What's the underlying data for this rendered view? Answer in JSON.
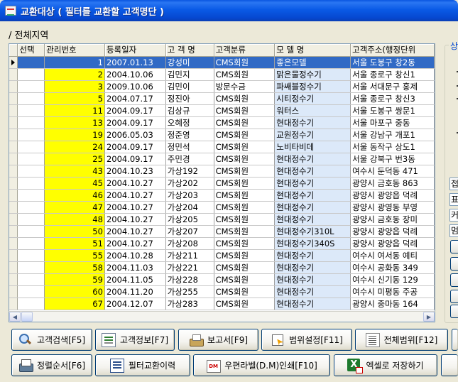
{
  "window": {
    "title": "교환대상 ( 필터를 교환할 고객명단 )"
  },
  "region": {
    "label": "/ 전체지역"
  },
  "grid": {
    "columns": [
      "선택",
      "관리번호",
      "등록일자",
      "고 객 명",
      "고객분류",
      "모 델 명",
      "고객주소(행정단위"
    ],
    "rows": [
      [
        "",
        "1",
        "2007.01.13",
        "강성미",
        "CMS회원",
        "좋은모델",
        "서울 도봉구 창2동"
      ],
      [
        "",
        "2",
        "2004.10.06",
        "김민지",
        "CMS회원",
        "맑은물정수기",
        "서울 종로구 창신1"
      ],
      [
        "",
        "3",
        "2009.10.06",
        "김민이",
        "방문수금",
        "파쌔블정수기",
        "서울 서대문구 홍제"
      ],
      [
        "",
        "5",
        "2004.07.17",
        "정진아",
        "CMS회원",
        "시티정수기",
        "서울 종로구 창신3"
      ],
      [
        "",
        "11",
        "2004.09.17",
        "김상규",
        "CMS회원",
        "워터스",
        "서울 도봉구 쌍문1"
      ],
      [
        "",
        "13",
        "2004.09.17",
        "오혜정",
        "CMS회원",
        "현대정수기",
        "서울 마포구 중동"
      ],
      [
        "",
        "19",
        "2006.05.03",
        "정준영",
        "CMS회원",
        "교원정수기",
        "서울 강남구 개포1"
      ],
      [
        "",
        "24",
        "2004.09.17",
        "정민석",
        "CMS회원",
        "노비타비데",
        "서울 동작구 상도1"
      ],
      [
        "",
        "25",
        "2004.09.17",
        "주민경",
        "CMS회원",
        "현대정수기",
        "서울 강북구 번3동"
      ],
      [
        "",
        "43",
        "2004.10.23",
        "가상192",
        "CMS회원",
        "현대정수기",
        "여수시 둔덕동 471"
      ],
      [
        "",
        "45",
        "2004.10.27",
        "가상202",
        "CMS회원",
        "현대정수기",
        "광양시 금호동 863"
      ],
      [
        "",
        "46",
        "2004.10.27",
        "가상203",
        "CMS회원",
        "현대정수기",
        "광양시 광양읍 덕례"
      ],
      [
        "",
        "47",
        "2004.10.27",
        "가상204",
        "CMS회원",
        "현대정수기",
        "광양시 광영동 부영"
      ],
      [
        "",
        "48",
        "2004.10.27",
        "가상205",
        "CMS회원",
        "현대정수기",
        "광양시 금호동 장미"
      ],
      [
        "",
        "50",
        "2004.10.27",
        "가상207",
        "CMS회원",
        "현대정수기310L",
        "광양시 광양읍 덕례"
      ],
      [
        "",
        "51",
        "2004.10.27",
        "가상208",
        "CMS회원",
        "현대정수기340S",
        "광양시 광양읍 덕례"
      ],
      [
        "",
        "55",
        "2004.10.28",
        "가상211",
        "CMS회원",
        "현대정수기",
        "여수시 여서동 예티"
      ],
      [
        "",
        "58",
        "2004.11.03",
        "가상221",
        "CMS회원",
        "현대정수기",
        "여수시 공화동 349"
      ],
      [
        "",
        "59",
        "2004.11.05",
        "가상228",
        "CMS회원",
        "현대정수기",
        "여수시 신기동 129"
      ],
      [
        "",
        "60",
        "2004.11.20",
        "가상255",
        "CMS회원",
        "현대정수기",
        "여수시 미평동 주공"
      ],
      [
        "",
        "67",
        "2004.12.07",
        "가상283",
        "CMS회원",
        "현대정수기",
        "광양시 중마동 164"
      ]
    ]
  },
  "side_panel": {
    "group_title": "상",
    "fields": [
      "접",
      "표",
      "커",
      "멈"
    ]
  },
  "buttons_row1": [
    {
      "label": "고객검색[F5]",
      "icon": "search-icon"
    },
    {
      "label": "고객정보[F7]",
      "icon": "info-icon"
    },
    {
      "label": "보고서[F9]",
      "icon": "printer-icon"
    },
    {
      "label": "범위설정[F11]",
      "icon": "range-icon"
    },
    {
      "label": "전체범위[F12]",
      "icon": "document-icon"
    }
  ],
  "buttons_row2": [
    {
      "label": "정렬순서[F6]",
      "icon": "sort-icon"
    },
    {
      "label": "필터교환이력",
      "icon": "list-icon"
    },
    {
      "label": "우편라벨(D.M)인쇄[F10]",
      "icon": "label-icon"
    },
    {
      "label": "엑셀로 저장하기",
      "icon": "excel-icon"
    }
  ]
}
